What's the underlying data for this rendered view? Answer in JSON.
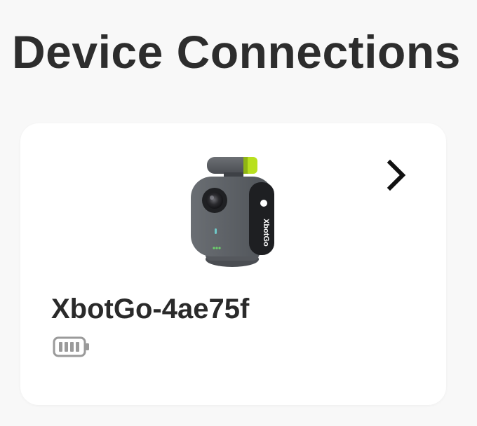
{
  "header": {
    "title": "Device Connections"
  },
  "device": {
    "name": "XbotGo-4ae75f",
    "brand_text": "XbotGo",
    "battery_level": 1.0,
    "image_icon": "xbotgo-camera-image",
    "open_icon": "chevron-right-icon",
    "battery_icon": "battery-full-icon"
  },
  "colors": {
    "background": "#f8f8f8",
    "card": "#ffffff",
    "title_text": "#2d2d2d",
    "device_body": "#5f6368",
    "accent_green": "#b8e01e",
    "battery_outline": "#9a9a9a"
  }
}
